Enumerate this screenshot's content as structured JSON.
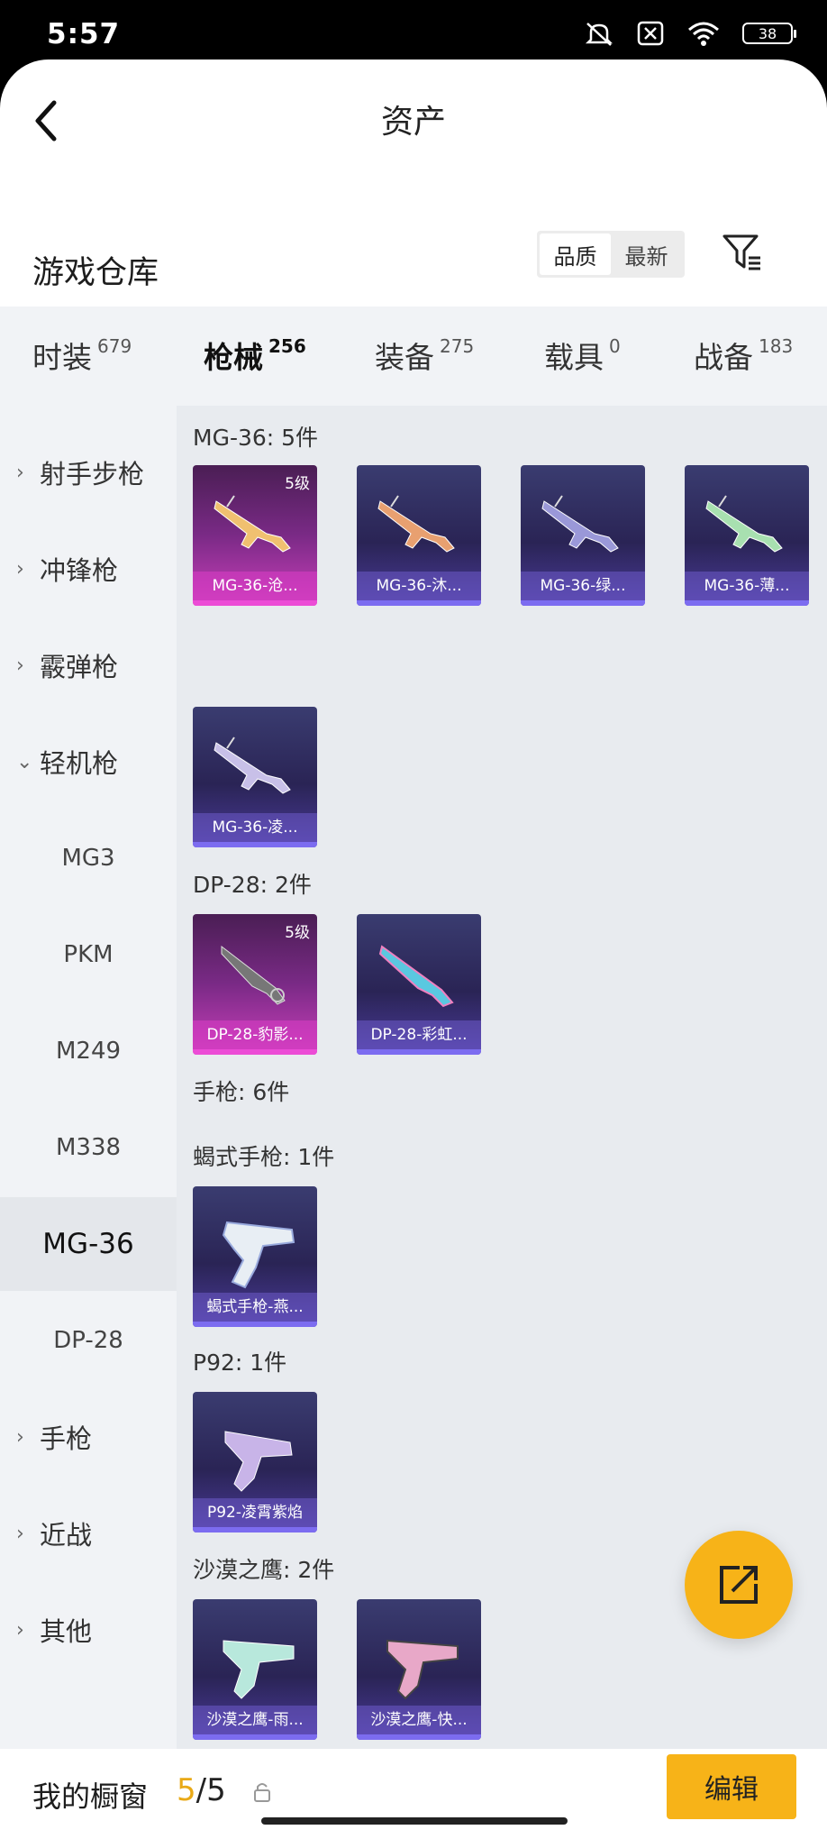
{
  "status": {
    "time": "5:57",
    "battery": "38"
  },
  "nav": {
    "title": "资产"
  },
  "warehouse": {
    "label": "游戏仓库",
    "sort": [
      "品质",
      "最新"
    ]
  },
  "categories": [
    {
      "label": "时装",
      "count": "679"
    },
    {
      "label": "枪械",
      "count": "256"
    },
    {
      "label": "装备",
      "count": "275"
    },
    {
      "label": "载具",
      "count": "0"
    },
    {
      "label": "战备",
      "count": "183"
    }
  ],
  "sidebar": [
    {
      "label": "射手步枪",
      "chev": "›"
    },
    {
      "label": "冲锋枪",
      "chev": "›"
    },
    {
      "label": "霰弹枪",
      "chev": "›"
    },
    {
      "label": "轻机枪",
      "chev": "⌄"
    },
    {
      "label": "MG3"
    },
    {
      "label": "PKM"
    },
    {
      "label": "M249"
    },
    {
      "label": "M338"
    },
    {
      "label": "MG-36"
    },
    {
      "label": "DP-28"
    },
    {
      "label": "手枪",
      "chev": "›"
    },
    {
      "label": "近战",
      "chev": "›"
    },
    {
      "label": "其他",
      "chev": "›"
    }
  ],
  "groups": [
    {
      "title": "MG-36: 5件"
    },
    {
      "title": "DP-28: 2件"
    },
    {
      "title": "手枪: 6件"
    },
    {
      "title": "蝎式手枪: 1件"
    },
    {
      "title": "P92: 1件"
    },
    {
      "title": "沙漠之鹰: 2件"
    }
  ],
  "cards": [
    {
      "name": "MG-36-沧...",
      "level": "5级",
      "rarity": "gold"
    },
    {
      "name": "MG-36-沐...",
      "level": "",
      "rarity": "purple"
    },
    {
      "name": "MG-36-绿...",
      "level": "",
      "rarity": "purple"
    },
    {
      "name": "MG-36-薄...",
      "level": "",
      "rarity": "purple"
    },
    {
      "name": "MG-36-凌...",
      "level": "",
      "rarity": "purple"
    },
    {
      "name": "DP-28-豹影...",
      "level": "5级",
      "rarity": "gold"
    },
    {
      "name": "DP-28-彩虹...",
      "level": "",
      "rarity": "purple"
    },
    {
      "name": "蝎式手枪-燕...",
      "level": "",
      "rarity": "purple"
    },
    {
      "name": "P92-凌霄紫焰",
      "level": "",
      "rarity": "purple"
    },
    {
      "name": "沙漠之鹰-雨...",
      "level": "",
      "rarity": "purple"
    },
    {
      "name": "沙漠之鹰-快...",
      "level": "",
      "rarity": "purple"
    }
  ],
  "showcase": {
    "label": "我的橱窗",
    "current": "5",
    "sep": "/",
    "total": "5",
    "edit": "编辑"
  },
  "colors": {
    "accent": "#f7b318",
    "gold_rarity": "#ec4cd6",
    "purple_rarity": "#7c6cf0"
  },
  "icons": [
    "back-arrow-icon",
    "filter-icon",
    "share-icon",
    "lock-icon",
    "mute-icon",
    "wifi-icon",
    "battery-icon"
  ]
}
